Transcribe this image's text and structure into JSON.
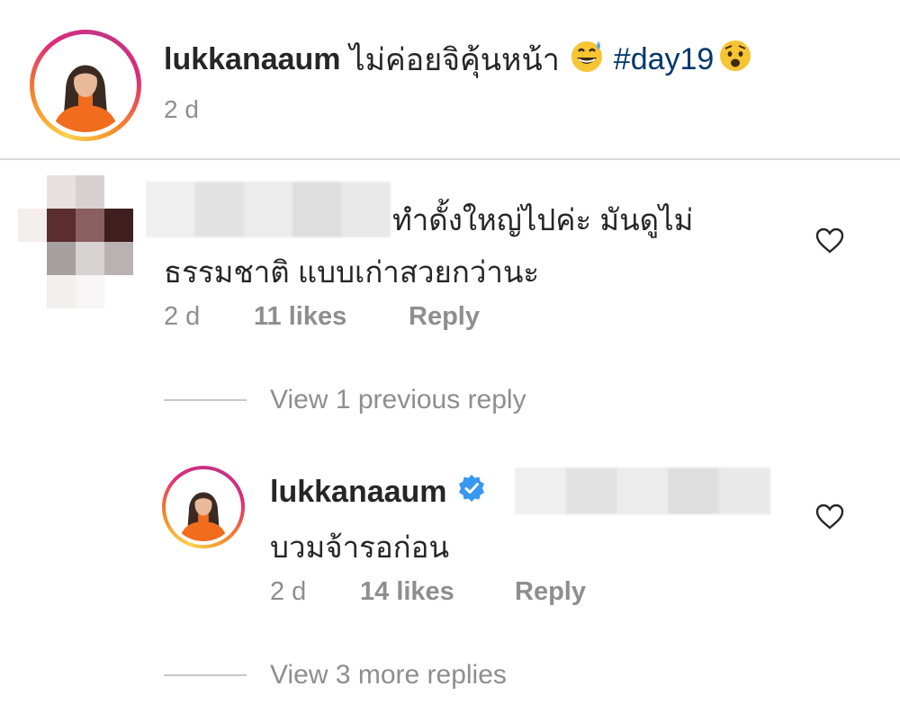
{
  "caption": {
    "username": "lukkanaaum",
    "text": "ไม่ค่อยจิคุ้นหน้า",
    "hashtag": "#day19",
    "time": "2 d"
  },
  "comment": {
    "text_line1": "ทำดั้งใหญ่ไปค่ะ มันดูไม่",
    "text_line2": "ธรรมชาติ แบบเก่าสวยกว่านะ",
    "time": "2 d",
    "likes": "11 likes",
    "reply_label": "Reply",
    "view_replies_label": "View 1 previous reply"
  },
  "reply": {
    "username": "lukkanaaum",
    "text": "บวมจ้ารอก่อน",
    "time": "2 d",
    "likes": "14 likes",
    "reply_label": "Reply",
    "view_more_label": "View 3 more replies"
  },
  "colors": {
    "text": "#262626",
    "muted": "#8e8e8e",
    "hashtag": "#00376b",
    "verified": "#3897f0",
    "divider": "#dbdbdb"
  },
  "icons": [
    "grinning-sweat-emoji",
    "anguished-emoji",
    "verified-badge-icon",
    "heart-icon"
  ]
}
